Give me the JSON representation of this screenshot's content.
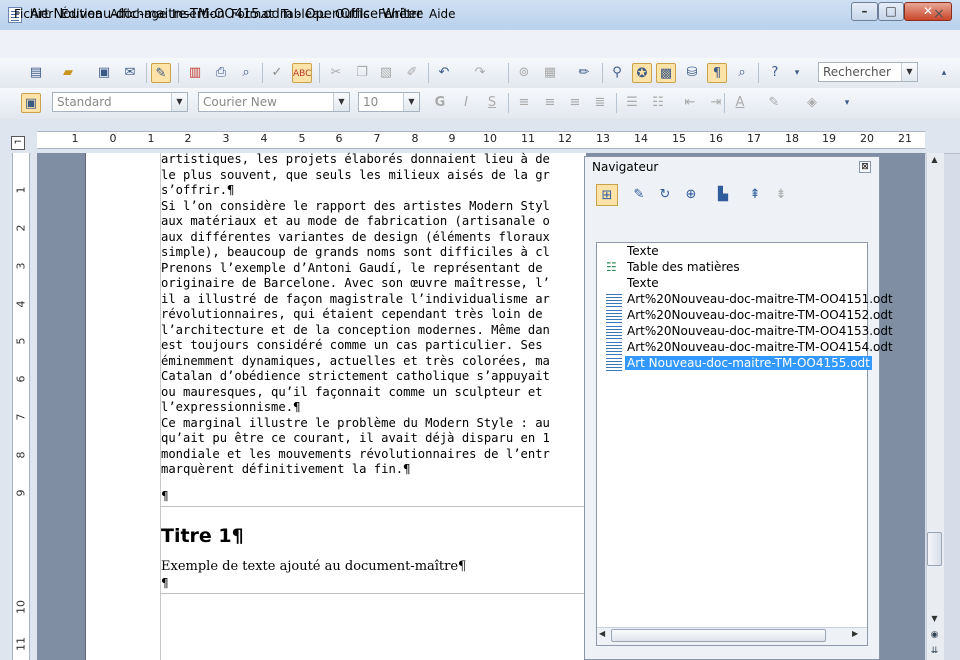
{
  "window": {
    "title": "Art Nouveau-doc-maitre-TM-OO415.odm - OpenOffice Writer",
    "min": "–",
    "max": "□",
    "close": "✕"
  },
  "menu": [
    "Fichier",
    "Édition",
    "Affichage",
    "Insertion",
    "Format",
    "Tableau",
    "Outils",
    "Fenêtre",
    "Aide"
  ],
  "menu_close": "×",
  "toolbar": {
    "search_placeholder": "Rechercher"
  },
  "format_bar": {
    "style": "Standard",
    "font": "Courier New",
    "size": "10"
  },
  "ruler_numbers": [
    "1",
    "0",
    "1",
    "2",
    "3",
    "4",
    "5",
    "6",
    "7",
    "8",
    "9",
    "10",
    "11",
    "12",
    "13",
    "14",
    "15",
    "16",
    "17",
    "18",
    "19",
    "20",
    "21"
  ],
  "vruler_numbers": [
    "1",
    "2",
    "3",
    "4",
    "5",
    "6",
    "7",
    "8",
    "9",
    "10",
    "11"
  ],
  "document": {
    "lines": [
      "artistiques, les projets élaborés donnaient lieu à de",
      "le plus souvent, que seuls les milieux aisés de la gr",
      "s’offrir.¶",
      "Si l’on considère le rapport des artistes Modern Styl",
      "aux matériaux et au mode de fabrication (artisanale o",
      "aux différentes variantes de design (éléments floraux",
      "simple), beaucoup de grands noms sont difficiles à cl",
      "Prenons l’exemple d’Antoni Gaudí, le représentant de ",
      "originaire de Barcelone. Avec son œuvre maîtresse, l’",
      "il a illustré de façon magistrale l’individualisme ar",
      "révolutionnaires, qui étaient cependant très loin de ",
      "l’architecture et de la conception modernes. Même dan",
      "est toujours considéré comme un cas particulier. Ses ",
      "éminemment dynamiques, actuelles et très colorées, ma",
      "Catalan d’obédience strictement catholique s’appuyait",
      "ou mauresques, qu’il façonnait comme un sculpteur et ",
      "l’expressionnisme.¶",
      "Ce marginal illustre le problème du Modern Style : au",
      "qu’ait pu être ce courant, il avait déjà disparu en 1",
      "mondiale et les mouvements révolutionnaires de l’entr",
      "marquèrent définitivement la fin.¶"
    ],
    "pilcrow_1": "¶",
    "heading": "Titre 1¶",
    "sample": "Exemple de texte ajouté au document-maître¶",
    "pilcrow_2": "¶"
  },
  "navigator": {
    "title": "Navigateur",
    "close": "⊠",
    "items": [
      "Texte",
      "Table des matières",
      "Texte",
      "Art%20Nouveau-doc-maitre-TM-OO4151.odt",
      "Art%20Nouveau-doc-maitre-TM-OO4152.odt",
      "Art%20Nouveau-doc-maitre-TM-OO4153.odt",
      "Art%20Nouveau-doc-maitre-TM-OO4154.odt",
      "Art Nouveau-doc-maitre-TM-OO4155.odt"
    ],
    "selected_color": "#3399ff"
  },
  "colors": {
    "accent": "#3399ff",
    "toggle_on": "#fde3a7"
  }
}
